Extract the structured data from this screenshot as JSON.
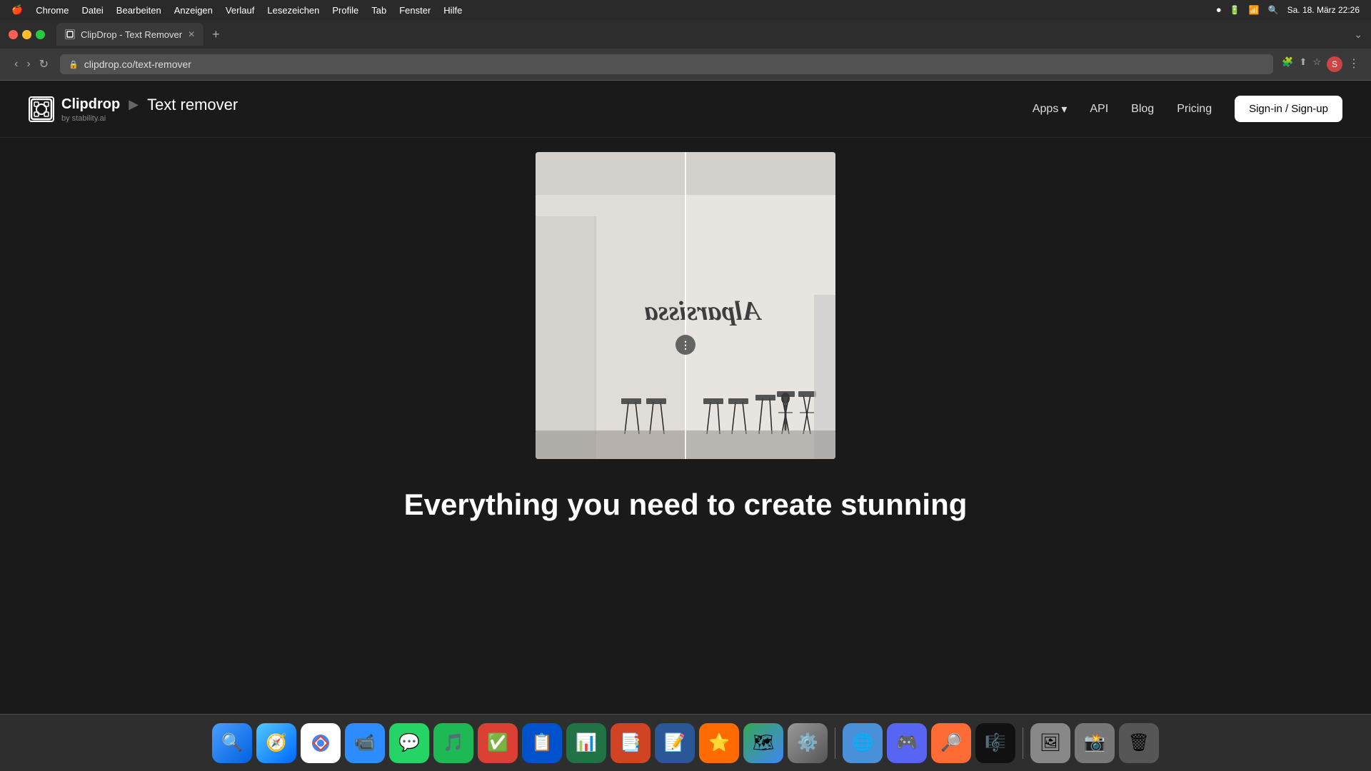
{
  "macos": {
    "apple": "🍎",
    "menu_items": [
      "Chrome",
      "Datei",
      "Bearbeiten",
      "Anzeigen",
      "Verlauf",
      "Lesezeichen",
      "Profile",
      "Tab",
      "Fenster",
      "Hilfe"
    ],
    "datetime": "Sa. 18. März  22:26",
    "tab_title": "ClipDrop - Text Remover",
    "tab_url": "clipdrop.co/text-remover"
  },
  "header": {
    "logo_name": "Clipdrop",
    "logo_sub": "by stability.ai",
    "breadcrumb_sep": "▶",
    "page_title": "Text remover",
    "nav": {
      "apps": "Apps",
      "api": "API",
      "blog": "Blog",
      "pricing": "Pricing",
      "signin": "Sign-in / Sign-up"
    }
  },
  "bottom_text": "Everything you need to create stunning",
  "divider_handle": "⋮",
  "dock_items": [
    {
      "name": "finder",
      "bg": "#2d6be4",
      "icon": "🔍"
    },
    {
      "name": "safari",
      "bg": "#1a73e8",
      "icon": "🧭"
    },
    {
      "name": "chrome",
      "bg": "#4285f4",
      "icon": "🌐"
    },
    {
      "name": "zoom",
      "bg": "#2d8cff",
      "icon": "📹"
    },
    {
      "name": "whatsapp",
      "bg": "#25d366",
      "icon": "💬"
    },
    {
      "name": "spotify",
      "bg": "#1db954",
      "icon": "🎵"
    },
    {
      "name": "todoist",
      "bg": "#db4035",
      "icon": "✅"
    },
    {
      "name": "trello",
      "bg": "#0052cc",
      "icon": "📋"
    },
    {
      "name": "excel",
      "bg": "#217346",
      "icon": "📊"
    },
    {
      "name": "powerpoint",
      "bg": "#d04423",
      "icon": "📑"
    },
    {
      "name": "word",
      "bg": "#2b5797",
      "icon": "📝"
    },
    {
      "name": "reeder",
      "bg": "#ff6d00",
      "icon": "⭐"
    },
    {
      "name": "maps",
      "bg": "#34a853",
      "icon": "🗺"
    },
    {
      "name": "prefs",
      "bg": "#888",
      "icon": "⚙️"
    },
    {
      "name": "balloon",
      "bg": "#4a90d9",
      "icon": "🌐"
    },
    {
      "name": "discord",
      "bg": "#5865f2",
      "icon": "🎮"
    },
    {
      "name": "proxyman",
      "bg": "#ff6b35",
      "icon": "🔎"
    },
    {
      "name": "music",
      "bg": "#333",
      "icon": "🎼"
    },
    {
      "name": "iphoto",
      "bg": "#555",
      "icon": "🖼"
    },
    {
      "name": "preview2",
      "bg": "#777",
      "icon": "📸"
    },
    {
      "name": "trash",
      "bg": "#999",
      "icon": "🗑"
    }
  ]
}
